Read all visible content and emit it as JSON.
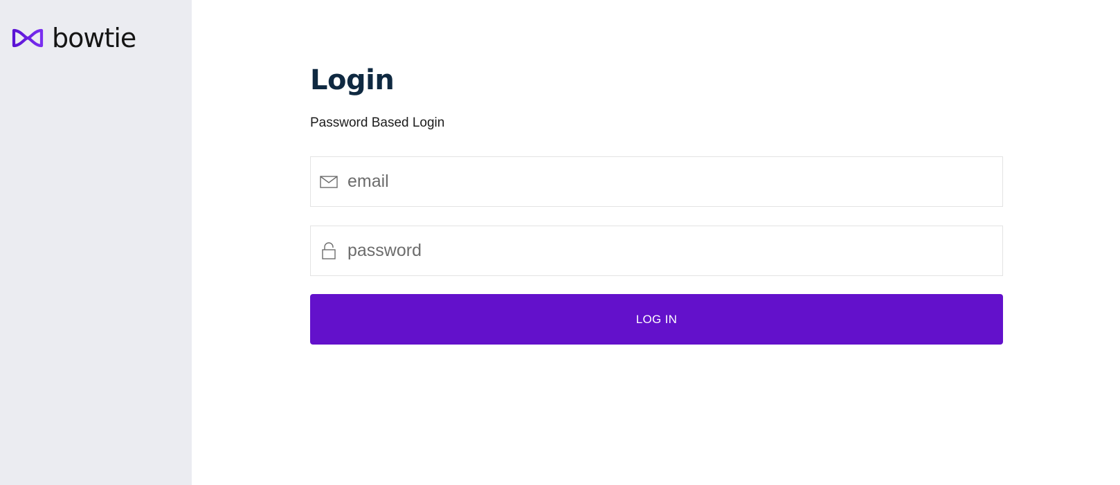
{
  "brand": {
    "name": "bowtie",
    "accent_color": "#6311cb",
    "logo_icon": "bowtie-logo-icon"
  },
  "login": {
    "title": "Login",
    "subtitle": "Password Based Login",
    "email": {
      "placeholder": "email",
      "value": "",
      "icon": "mail-icon"
    },
    "password": {
      "placeholder": "password",
      "value": "",
      "icon": "lock-icon"
    },
    "submit_label": "LOG IN"
  },
  "colors": {
    "sidebar_background": "#ebecf1",
    "title_color": "#0f2941",
    "button_background": "#6311cb"
  }
}
